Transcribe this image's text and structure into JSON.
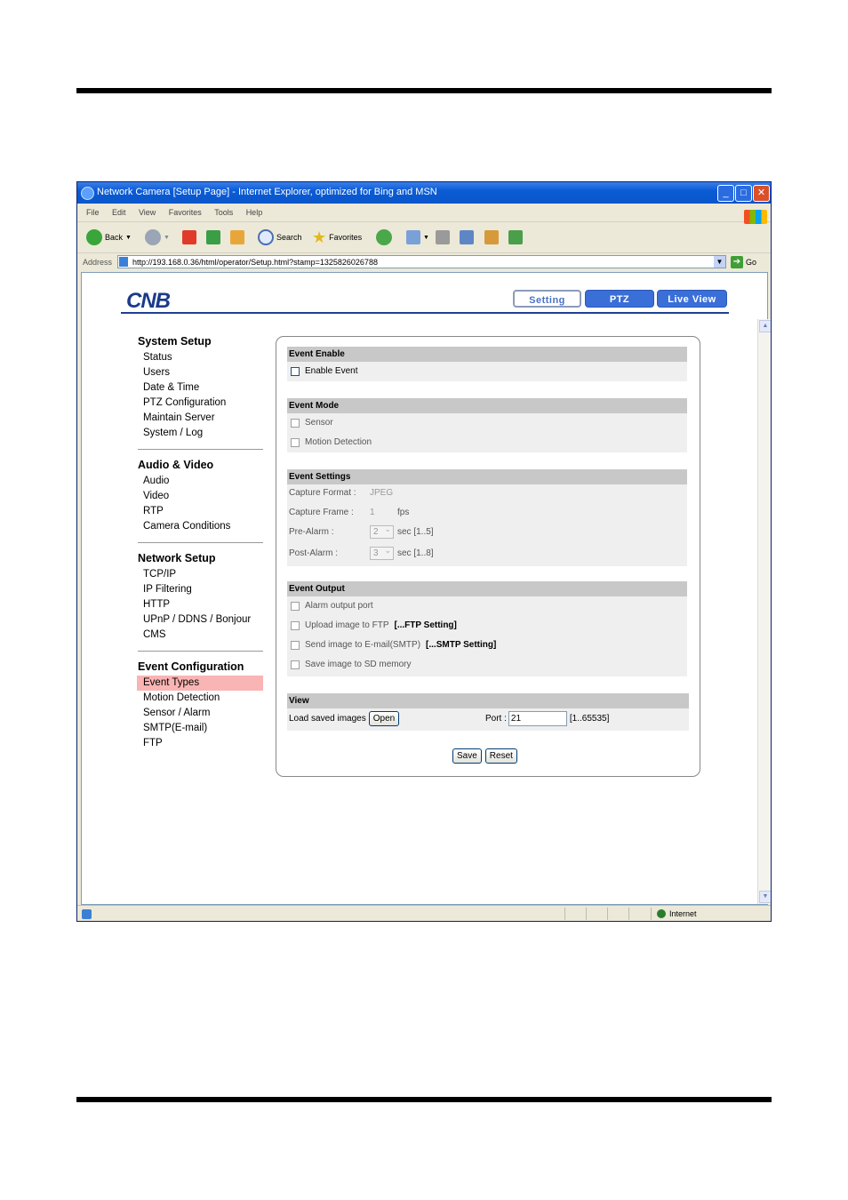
{
  "window": {
    "title": "Network Camera [Setup Page] - Internet Explorer, optimized for Bing and MSN",
    "controls": {
      "minimize": "_",
      "maximize": "□",
      "close": "✕"
    }
  },
  "menu": [
    "File",
    "Edit",
    "View",
    "Favorites",
    "Tools",
    "Help"
  ],
  "toolbar": {
    "back": "Back",
    "search": "Search",
    "favorites": "Favorites"
  },
  "address": {
    "label": "Address",
    "url": "http://193.168.0.36/html/operator/Setup.html?stamp=1325826026788",
    "go": "Go"
  },
  "brand": {
    "logo": "CNB"
  },
  "nav_tabs": {
    "setting": "Setting",
    "ptz": "PTZ",
    "live_view": "Live View"
  },
  "sidebar": {
    "system_setup": {
      "title": "System Setup",
      "items": [
        "Status",
        "Users",
        "Date & Time",
        "PTZ Configuration",
        "Maintain Server",
        "System / Log"
      ]
    },
    "audio_video": {
      "title": "Audio & Video",
      "items": [
        "Audio",
        "Video",
        "RTP",
        "Camera Conditions"
      ]
    },
    "network_setup": {
      "title": "Network Setup",
      "items": [
        "TCP/IP",
        "IP Filtering",
        "HTTP",
        "UPnP / DDNS / Bonjour",
        "CMS"
      ]
    },
    "event_configuration": {
      "title": "Event Configuration",
      "items": [
        "Event Types",
        "Motion Detection",
        "Sensor / Alarm",
        "SMTP(E-mail)",
        "FTP"
      ],
      "active_index": 0
    }
  },
  "panel": {
    "event_enable": {
      "header": "Event Enable",
      "enable_event": "Enable Event",
      "checked": false
    },
    "event_mode": {
      "header": "Event Mode",
      "sensor": "Sensor",
      "motion_detection": "Motion Detection"
    },
    "event_settings": {
      "header": "Event Settings",
      "capture_format_label": "Capture Format :",
      "capture_format_value": "JPEG",
      "capture_frame_label": "Capture Frame :",
      "capture_frame_value": "1",
      "capture_frame_unit": "fps",
      "pre_alarm_label": "Pre-Alarm :",
      "pre_alarm_value": "2",
      "pre_alarm_range": "sec [1..5]",
      "post_alarm_label": "Post-Alarm :",
      "post_alarm_value": "3",
      "post_alarm_range": "sec [1..8]"
    },
    "event_output": {
      "header": "Event Output",
      "alarm_output": "Alarm output port",
      "upload_ftp": "Upload image to FTP",
      "ftp_setting": "[...FTP Setting]",
      "send_email": "Send image to E-mail(SMTP)",
      "smtp_setting": "[...SMTP Setting]",
      "save_sd": "Save image to SD memory"
    },
    "view": {
      "header": "View",
      "load_saved": "Load saved images",
      "open": "Open",
      "port_label": "Port :",
      "port_value": "21",
      "port_range": "[1..65535]"
    },
    "buttons": {
      "save": "Save",
      "reset": "Reset"
    }
  },
  "status": {
    "zone": "Internet"
  }
}
